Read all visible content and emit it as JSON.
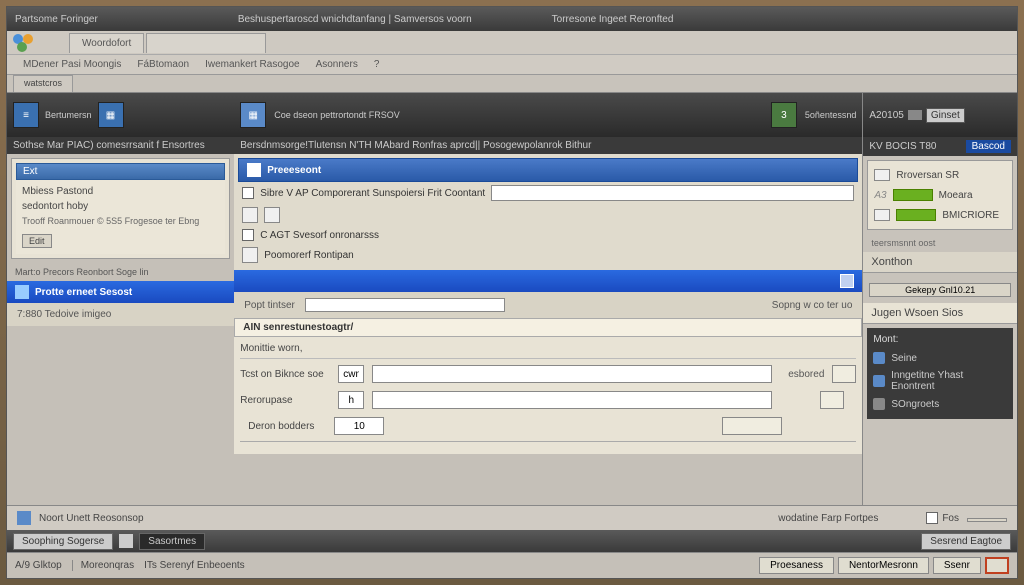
{
  "titlebar": {
    "app": "Partsome Foringer",
    "center1": "Beshuspertaroscd wnichdtanfang | Samversos voorn",
    "center2": "Torresone Ingeet Reronfted"
  },
  "menubar": {
    "tab1": "Woordofort"
  },
  "secondary": {
    "m1": "MDener Pasi Moongis",
    "m2": "FáBtomaon",
    "m3": "Iwemankert Rasogoe",
    "m4": "Asonners",
    "help": "?"
  },
  "tabs": {
    "t1": "watstcros"
  },
  "left": {
    "toolbar_txt": "Bertumersn",
    "band": "Sothse Mar   PIAC) comesrrsanit f Ensortres",
    "panel_head": "Ext",
    "p1": "Mbiess Pastond",
    "p2": "sedontort hoby",
    "p3": "Trooff Roanmouer  © 5S5 Frogesoe ter Ebng",
    "btn": "Edit",
    "note": "Mart:o Precors Reonbort Soge lin"
  },
  "mid": {
    "toolbar1": "Coe dseon pettrortondt FRSOV",
    "toolbar2": "5oñentessnd",
    "toolbar_band": "Bersdnmsorge!Tlutensn N'TH MAbard Ronfras aprcd|| Posogewpolanrok Bithur",
    "header1": "Preeeseont",
    "row1_label": "Sibre V AP Comporerant Sunspoiersi Frit Coontant",
    "row2_label": "C AGT Svesorf onronarsss",
    "row3_label": "Poomorerf Rontipan",
    "bluebar": "Protte erneet Sesost",
    "search_l": "7:880 Tedoive imigeo",
    "search_m": "Popt tintser",
    "search_r": "Sopng w co ter uo",
    "section": "AIN senrestunestoagtr/",
    "form_head": "Monittie worn,",
    "f1_label": "Tcst on Biknce soe",
    "f1_val": "cwn",
    "f1_after": "esbored",
    "f2_label": "Rerorupase",
    "f2_val": "h",
    "f3_label": "Deron bodders",
    "f3_val": "10"
  },
  "right": {
    "top_l": "A20105",
    "top_btn": "Ginset",
    "band_l": "KV BOCIS T80",
    "band_btn": "Bascod",
    "item1": "Rroversan SR",
    "item2": "Moeara",
    "item3": "BMICRIORE",
    "sec_h": "Xonthon",
    "sec_btn": "Gekepy Gnl10.21",
    "side_h": "Jugen Wsoen Sios",
    "dark_h": "Mont:",
    "d1": "Seine",
    "d2": "Inngetitne Yhast Enontrent",
    "d3": "SOngroets"
  },
  "bottom": {
    "act_l": "Noort Unett Reosonsop",
    "act_r": "wodatine Farp Fortpes",
    "chk": "Fos"
  },
  "status": {
    "t1": "Soophing Sogerse",
    "t2": "Sasortmes",
    "r1": "Sesrend Eagtoe"
  },
  "footer": {
    "f1": "A/9 Glktop",
    "f2": "Moreonqras",
    "f3": "ITs Serenyf Enbeoents",
    "b1": "Proesaness",
    "b2": "NentorMesronn",
    "b3": "Ssenr",
    "b4": ""
  }
}
